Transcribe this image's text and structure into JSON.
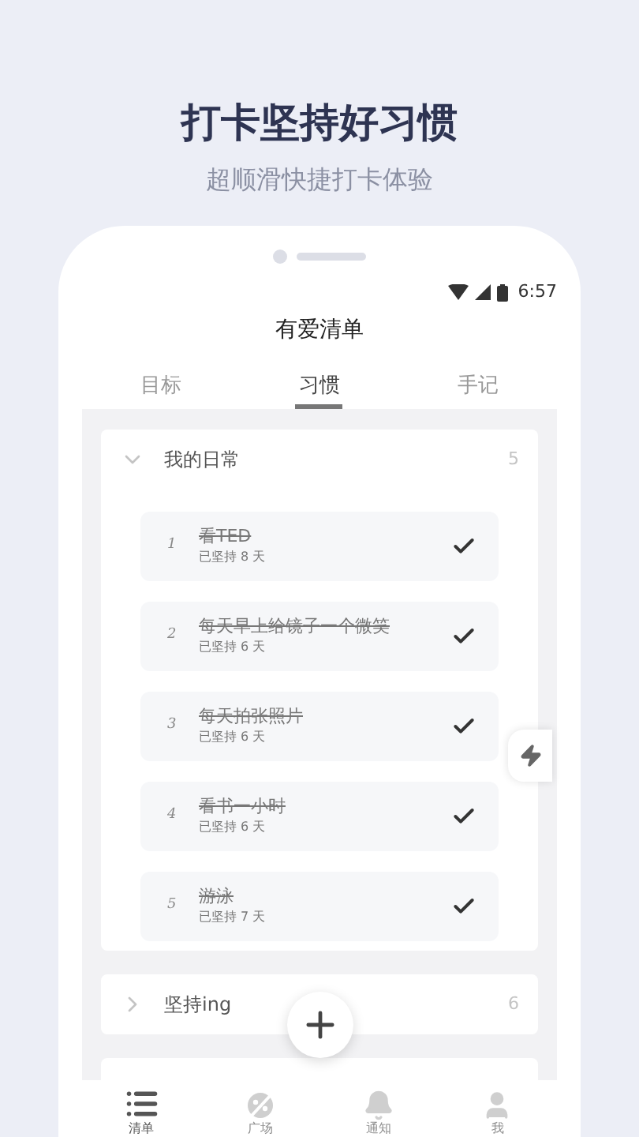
{
  "headline": "打卡坚持好习惯",
  "subheadline": "超顺滑快捷打卡体验",
  "status_bar": {
    "time": "6:57"
  },
  "app_title": "有爱清单",
  "tabs": [
    {
      "label": "目标",
      "selected": false
    },
    {
      "label": "习惯",
      "selected": true
    },
    {
      "label": "手记",
      "selected": false
    }
  ],
  "groups": [
    {
      "title": "我的日常",
      "count": "5",
      "expanded": true,
      "items": [
        {
          "index": "1",
          "title": "看TED",
          "streak": "已坚持 8 天",
          "done": true
        },
        {
          "index": "2",
          "title": "每天早上给镜子一个微笑",
          "streak": "已坚持 6 天",
          "done": true
        },
        {
          "index": "3",
          "title": "每天拍张照片",
          "streak": "已坚持 6 天",
          "done": true
        },
        {
          "index": "4",
          "title": "看书一小时",
          "streak": "已坚持 6 天",
          "done": true
        },
        {
          "index": "5",
          "title": "游泳",
          "streak": "已坚持 7 天",
          "done": true
        }
      ]
    },
    {
      "title": "坚持ing",
      "count": "6",
      "expanded": false
    }
  ],
  "bottom_nav": [
    {
      "label": "清单",
      "selected": true
    },
    {
      "label": "广场",
      "selected": false
    },
    {
      "label": "通知",
      "selected": false
    },
    {
      "label": "我",
      "selected": false
    }
  ]
}
